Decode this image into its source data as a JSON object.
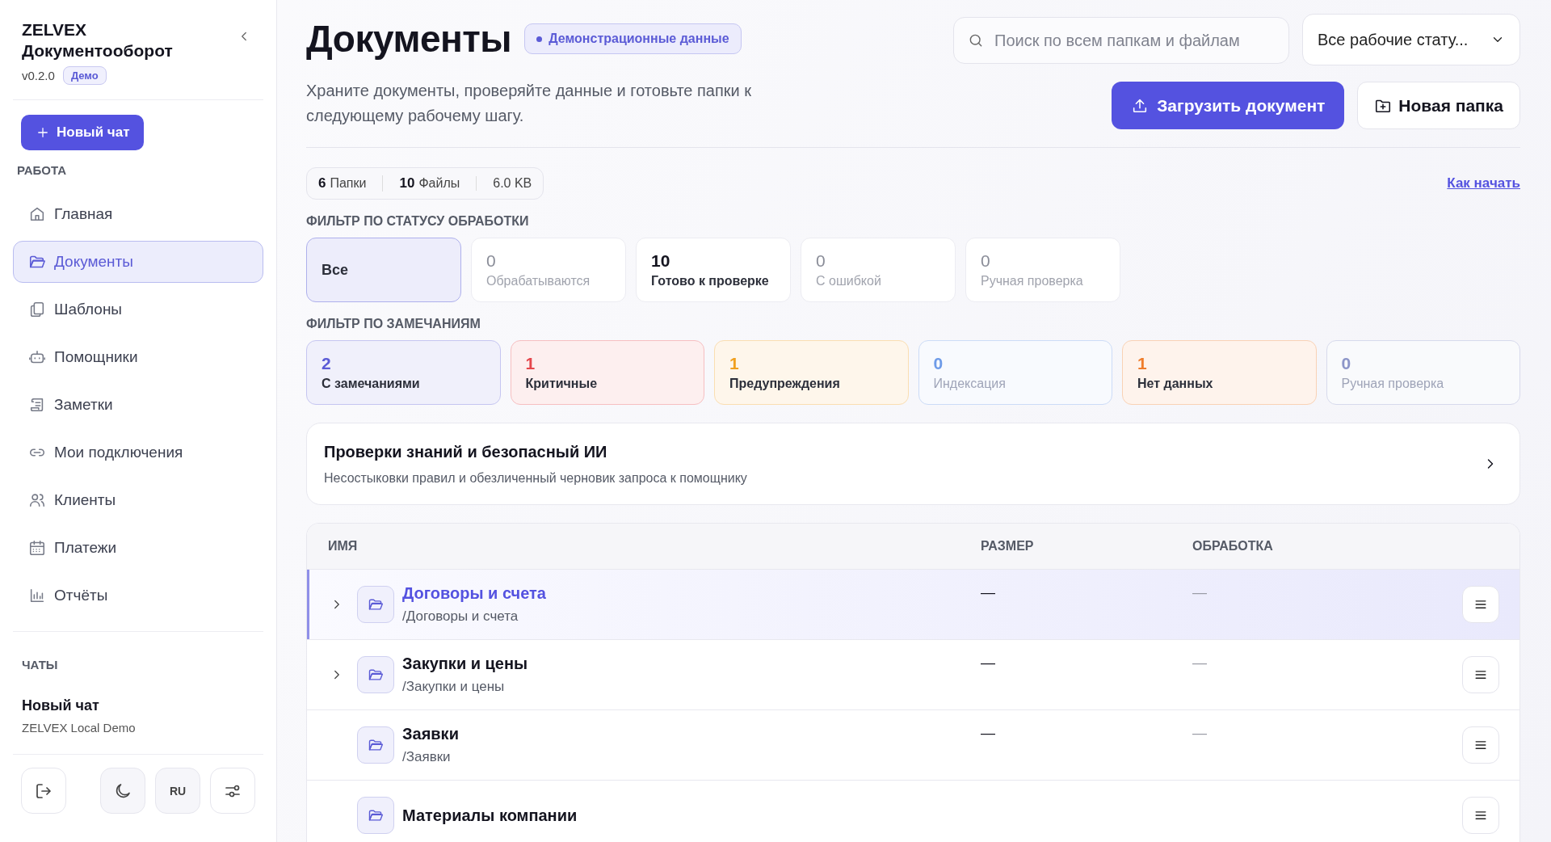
{
  "sidebar": {
    "brand": "ZELVEX",
    "product": "Документооборот",
    "version": "v0.2.0",
    "badge": "Демо",
    "new_chat": "Новый чат",
    "section": "РАБОТА",
    "nav": [
      {
        "label": "Главная",
        "selected": false
      },
      {
        "label": "Документы",
        "selected": true
      },
      {
        "label": "Шаблоны",
        "selected": false
      },
      {
        "label": "Помощники",
        "selected": false
      },
      {
        "label": "Заметки",
        "selected": false
      },
      {
        "label": "Мои подключения",
        "selected": false
      },
      {
        "label": "Клиенты",
        "selected": false
      },
      {
        "label": "Платежи",
        "selected": false
      },
      {
        "label": "Отчёты",
        "selected": false
      }
    ],
    "chats_title": "ЧАТЫ",
    "chats": [
      {
        "title": "Новый чат",
        "subtitle": "ZELVEX Local Demo"
      }
    ],
    "footer": [
      {
        "kind": "logout"
      },
      {
        "kind": "theme"
      },
      {
        "kind": "language",
        "label": "RU"
      },
      {
        "kind": "settings"
      }
    ]
  },
  "header": {
    "title": "Документы",
    "badge": "Демонстрационные данные",
    "description": "Храните документы, проверяйте данные и готовьте папки к следующему рабочему шагу.",
    "search": {
      "placeholder": "Поиск по всем папкам и файлам"
    },
    "status_select": "Все рабочие стату...",
    "upload_button": "Загрузить документ",
    "new_folder_button": "Новая папка"
  },
  "stats": [
    {
      "value": "6",
      "label": "Папки"
    },
    {
      "value": "10",
      "label": "Файлы"
    },
    {
      "label": "6.0 KB"
    }
  ],
  "help_link": "Как начать",
  "status_filter_title": "ФИЛЬТР ПО СТАТУСУ ОБРАБОТКИ",
  "status_filters": [
    {
      "label": "Все",
      "selected": true,
      "disabled": false
    },
    {
      "count": "0",
      "label": "Обрабатываются",
      "selected": false,
      "disabled": true
    },
    {
      "count": "10",
      "label": "Готово к проверке",
      "selected": false,
      "disabled": false
    },
    {
      "count": "0",
      "label": "С ошибкой",
      "selected": false,
      "disabled": true
    },
    {
      "count": "0",
      "label": "Ручная проверка",
      "selected": false,
      "disabled": true
    }
  ],
  "remarks_filter_title": "ФИЛЬТР ПО ЗАМЕЧАНИЯМ",
  "remark_filters": [
    {
      "count": "2",
      "label": "С замечаниями",
      "color": "#5b5bd6",
      "disabled": false
    },
    {
      "count": "1",
      "label": "Критичные",
      "color": "#e5484d",
      "disabled": false
    },
    {
      "count": "1",
      "label": "Предупреждения",
      "color": "#f0a020",
      "disabled": false
    },
    {
      "count": "0",
      "label": "Индексация",
      "color": "#6e9be8",
      "disabled": true
    },
    {
      "count": "1",
      "label": "Нет данных",
      "color": "#ef7d2c",
      "disabled": false
    },
    {
      "count": "0",
      "label": "Ручная проверка",
      "color": "#8c95c8",
      "disabled": true
    }
  ],
  "knowledge_card": {
    "title": "Проверки знаний и безопасный ИИ",
    "subtitle": "Несостыковки правил и обезличенный черновик запроса к помощнику"
  },
  "table": {
    "columns": [
      "ИМЯ",
      "РАЗМЕР",
      "ОБРАБОТКА"
    ],
    "rows": [
      {
        "name": "Договоры и счета",
        "path": "/Договоры и счета",
        "size": "—",
        "processing": "—",
        "has_children": true,
        "selected": true
      },
      {
        "name": "Закупки и цены",
        "path": "/Закупки и цены",
        "size": "—",
        "processing": "—",
        "has_children": true,
        "selected": false
      },
      {
        "name": "Заявки",
        "path": "/Заявки",
        "size": "—",
        "processing": "—",
        "has_children": false,
        "selected": false
      },
      {
        "name": "Материалы компании",
        "has_children": false,
        "selected": false
      }
    ]
  }
}
